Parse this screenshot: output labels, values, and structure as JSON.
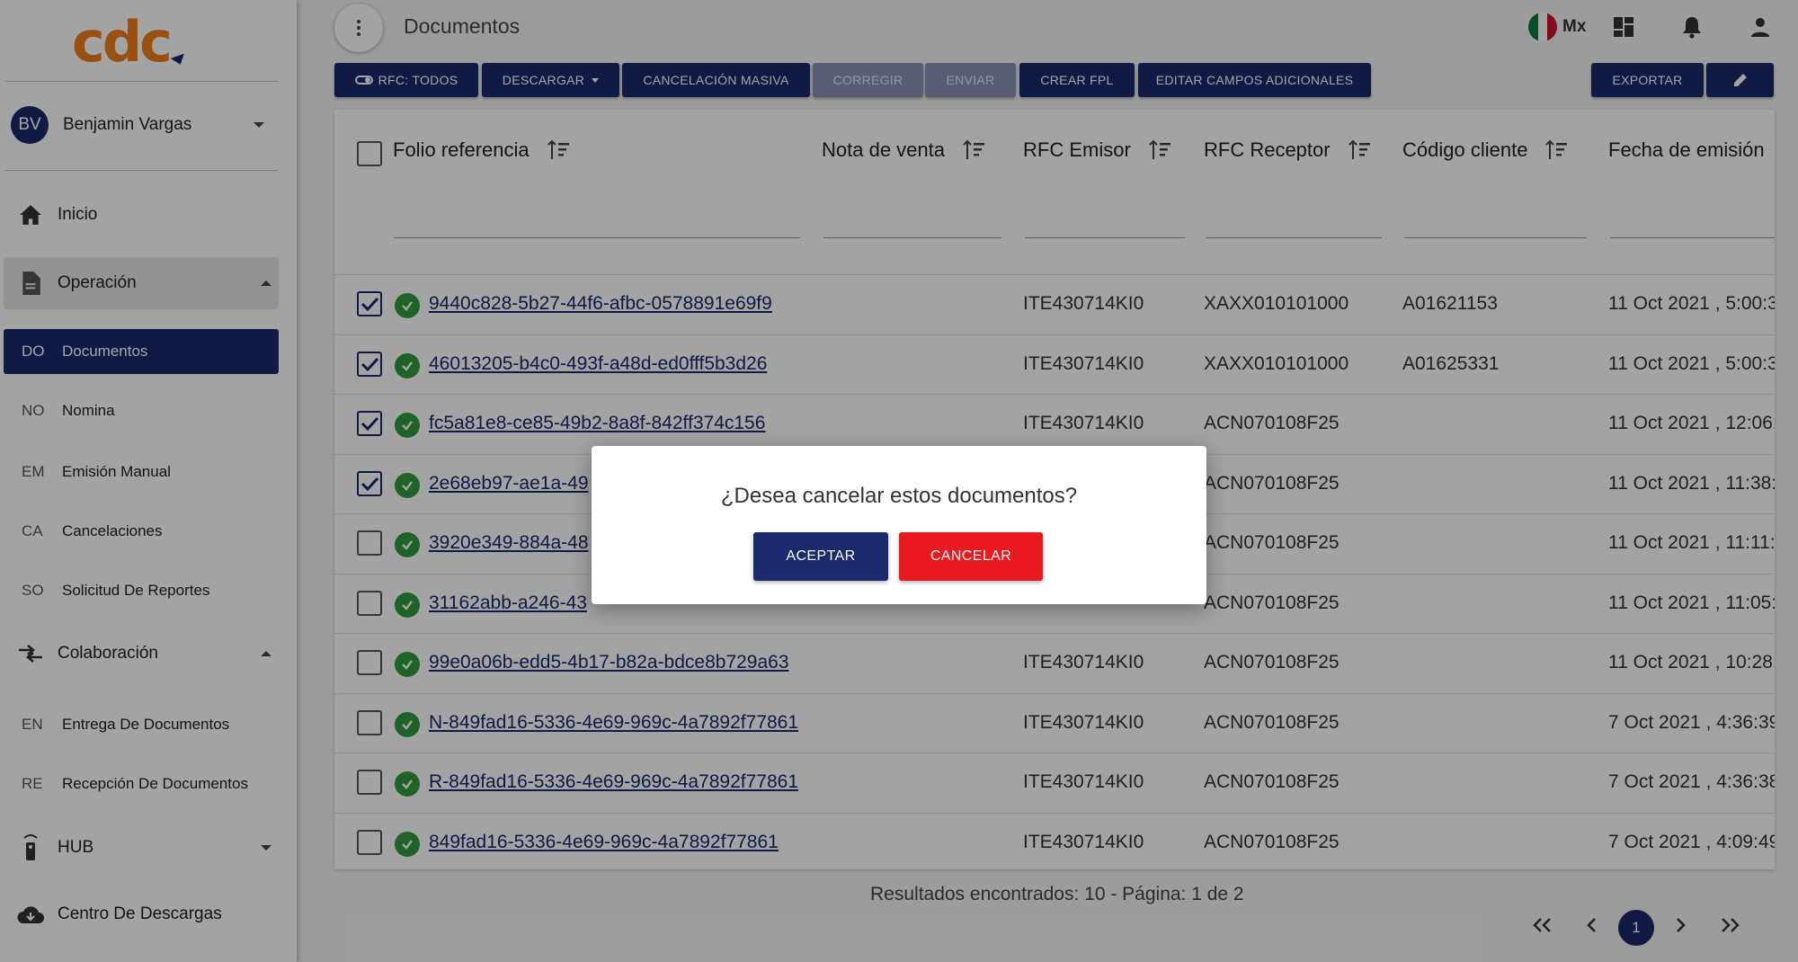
{
  "brand": {
    "logo_text": "cdc"
  },
  "user": {
    "initials": "BV",
    "name": "Benjamin Vargas"
  },
  "nav": {
    "inicio": "Inicio",
    "operacion": "Operación",
    "operacion_items": [
      {
        "abbr": "DO",
        "label": "Documentos"
      },
      {
        "abbr": "NO",
        "label": "Nomina"
      },
      {
        "abbr": "EM",
        "label": "Emisión Manual"
      },
      {
        "abbr": "CA",
        "label": "Cancelaciones"
      },
      {
        "abbr": "SO",
        "label": "Solicitud De Reportes"
      }
    ],
    "colaboracion": "Colaboración",
    "colaboracion_items": [
      {
        "abbr": "EN",
        "label": "Entrega De Documentos"
      },
      {
        "abbr": "RE",
        "label": "Recepción De Documentos"
      }
    ],
    "hub": "HUB",
    "centro": "Centro De Descargas"
  },
  "header": {
    "title": "Documentos",
    "country": "Mx"
  },
  "toolbar": {
    "rfc": "RFC: TODOS",
    "descargar": "DESCARGAR",
    "cancelacion": "CANCELACIÓN MASIVA",
    "corregir": "CORREGIR",
    "enviar": "ENVIAR",
    "crear_fpl": "CREAR FPL",
    "editar": "EDITAR CAMPOS ADICIONALES",
    "exportar": "EXPORTAR"
  },
  "table": {
    "columns": [
      "Folio referencia",
      "Nota de venta",
      "RFC Emisor",
      "RFC Receptor",
      "Código cliente",
      "Fecha de emisión"
    ],
    "rows": [
      {
        "checked": true,
        "folio": "9440c828-5b27-44f6-afbc-0578891e69f9",
        "nota": "",
        "emisor": "ITE430714KI0",
        "receptor": "XAXX010101000",
        "cliente": "A01621153",
        "fecha": "11 Oct 2021 , 5:00:3"
      },
      {
        "checked": true,
        "folio": "46013205-b4c0-493f-a48d-ed0fff5b3d26",
        "nota": "",
        "emisor": "ITE430714KI0",
        "receptor": "XAXX010101000",
        "cliente": "A01625331",
        "fecha": "11 Oct 2021 , 5:00:3"
      },
      {
        "checked": true,
        "folio": "fc5a81e8-ce85-49b2-8a8f-842ff374c156",
        "nota": "",
        "emisor": "ITE430714KI0",
        "receptor": "ACN070108F25",
        "cliente": "",
        "fecha": "11 Oct 2021 , 12:06:"
      },
      {
        "checked": true,
        "folio": "2e68eb97-ae1a-49",
        "nota": "",
        "emisor": "",
        "receptor": "ACN070108F25",
        "cliente": "",
        "fecha": "11 Oct 2021 , 11:38:"
      },
      {
        "checked": false,
        "folio": "3920e349-884a-48",
        "nota": "",
        "emisor": "",
        "receptor": "ACN070108F25",
        "cliente": "",
        "fecha": "11 Oct 2021 , 11:11:"
      },
      {
        "checked": false,
        "folio": "31162abb-a246-43",
        "nota": "",
        "emisor": "",
        "receptor": "ACN070108F25",
        "cliente": "",
        "fecha": "11 Oct 2021 , 11:05:"
      },
      {
        "checked": false,
        "folio": "99e0a06b-edd5-4b17-b82a-bdce8b729a63",
        "nota": "",
        "emisor": "ITE430714KI0",
        "receptor": "ACN070108F25",
        "cliente": "",
        "fecha": "11 Oct 2021 , 10:28:"
      },
      {
        "checked": false,
        "folio": "N-849fad16-5336-4e69-969c-4a7892f77861",
        "nota": "",
        "emisor": "ITE430714KI0",
        "receptor": "ACN070108F25",
        "cliente": "",
        "fecha": "7 Oct 2021 , 4:36:39"
      },
      {
        "checked": false,
        "folio": "R-849fad16-5336-4e69-969c-4a7892f77861",
        "nota": "",
        "emisor": "ITE430714KI0",
        "receptor": "ACN070108F25",
        "cliente": "",
        "fecha": "7 Oct 2021 , 4:36:38"
      },
      {
        "checked": false,
        "folio": "849fad16-5336-4e69-969c-4a7892f77861",
        "nota": "",
        "emisor": "ITE430714KI0",
        "receptor": "ACN070108F25",
        "cliente": "",
        "fecha": "7 Oct 2021 , 4:09:49"
      }
    ]
  },
  "footer": {
    "results": "Resultados encontrados: 10 - Página: 1 de 2",
    "page": "1"
  },
  "dialog": {
    "question": "¿Desea cancelar estos documentos?",
    "accept": "ACEPTAR",
    "cancel": "CANCELAR"
  },
  "colors": {
    "primary": "#1a2a6c",
    "danger": "#e8191f",
    "success": "#2e9d3c",
    "logo": "#f07d19"
  }
}
